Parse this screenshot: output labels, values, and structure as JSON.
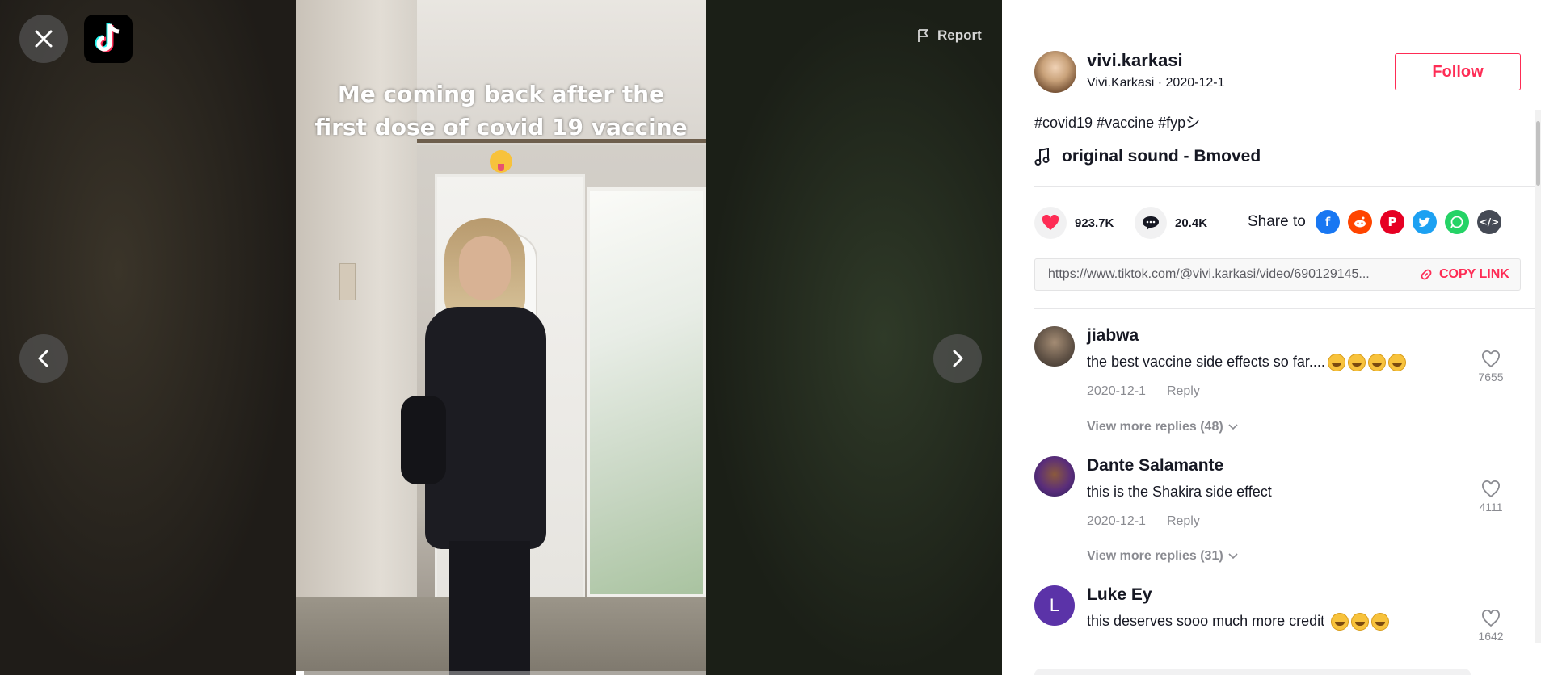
{
  "viewer": {
    "caption_line1": "Me coming back after the",
    "caption_line2": "first dose of covid 19 vaccine",
    "report_label": "Report",
    "progress": 0.02,
    "icons": {
      "close": "close-icon",
      "logo": "tiktok-logo",
      "prev": "chevron-left-icon",
      "next": "chevron-right-icon",
      "report": "flag-icon"
    }
  },
  "author": {
    "username": "vivi.karkasi",
    "nickname": "Vivi.Karkasi",
    "separator": "·",
    "date": "2020-12-1",
    "follow_label": "Follow"
  },
  "description": {
    "tags": "#covid19 #vaccine #fypシ",
    "sound": "original sound - Bmoved"
  },
  "stats": {
    "likes": "923.7K",
    "comments": "20.4K",
    "share_label": "Share to"
  },
  "share_targets": [
    "facebook-icon",
    "reddit-icon",
    "pinterest-icon",
    "twitter-icon",
    "whatsapp-icon",
    "embed-icon"
  ],
  "link": {
    "url": "https://www.tiktok.com/@vivi.karkasi/video/690129145...",
    "copy_label": "COPY LINK"
  },
  "comments": [
    {
      "name": "jiabwa",
      "text": "the best vaccine side effects so far....",
      "date": "2020-12-1",
      "reply": "Reply",
      "likes": "7655",
      "more": "View more replies (48)"
    },
    {
      "name": "Dante Salamante",
      "text": "this is the Shakira side effect",
      "date": "2020-12-1",
      "reply": "Reply",
      "likes": "4111",
      "more": "View more replies (31)"
    },
    {
      "name": "Luke Ey",
      "initial": "L",
      "text": "this deserves sooo much more credit",
      "likes": "1642"
    }
  ],
  "colors": {
    "accent": "#fe2c55",
    "text": "#161823",
    "muted": "#8a8b91"
  }
}
